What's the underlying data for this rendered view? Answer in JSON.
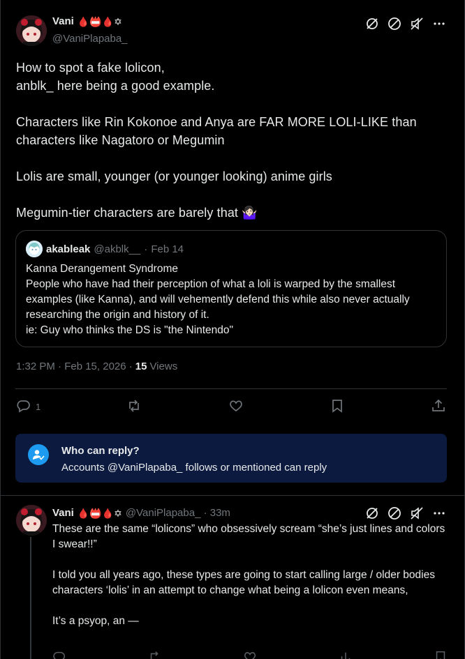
{
  "tweet": {
    "display_name": "Vani",
    "badges": "🩸📛🩸✡",
    "handle": "@VaniPlapaba_",
    "text": "How to spot a fake lolicon,\nanblk_ here being a good example.\n\nCharacters like Rin Kokonoe and Anya are FAR MORE LOLI-LIKE than characters like Nagatoro or Megumin\n\nLolis are small, younger (or younger looking) anime girls\n\nMegumin-tier characters are barely that 🤷🏻‍♀️",
    "timestamp": "1:32 PM · Feb 15, 2026 ·",
    "views_count": "15",
    "views_label": "Views",
    "reply_count": "1"
  },
  "quote": {
    "name": "akableak",
    "handle": "@akblk__",
    "separator": "·",
    "date": "Feb 14",
    "text": "Kanna Derangement Syndrome\nPeople who have had their perception of what a loli is warped by the smallest examples (like Kanna), and will vehemently defend this while also never actually researching the origin and history of it.\nie: Guy who thinks the DS is \"the Nintendo\""
  },
  "reply_restriction": {
    "title": "Who can reply?",
    "subtitle": "Accounts @VaniPlapaba_ follows or mentioned can reply"
  },
  "reply": {
    "display_name": "Vani",
    "badges": "🩸📛🩸✡",
    "handle_time": "@VaniPlapaba_ · 33m",
    "text": "These are the same “lolicons” who obsessively scream “she’s just lines and colors I swear!!”\n\nI told you all years ago, these types are going to start calling large / older bodies characters ‘lolis’ in an attempt to change what being a lolicon even means,\n\nIt’s a psyop, an —"
  },
  "icons": {
    "top": [
      "grok-icon",
      "block-icon",
      "mute-icon",
      "more-icon"
    ],
    "actions": [
      "reply-icon",
      "repost-icon",
      "like-icon",
      "bookmark-icon",
      "share-icon"
    ]
  },
  "colors": {
    "accent": "#1d9bf0",
    "banner_bg": "#0c1a3f",
    "text": "#e7e9ea",
    "muted": "#71767b",
    "border": "#2f3336"
  }
}
